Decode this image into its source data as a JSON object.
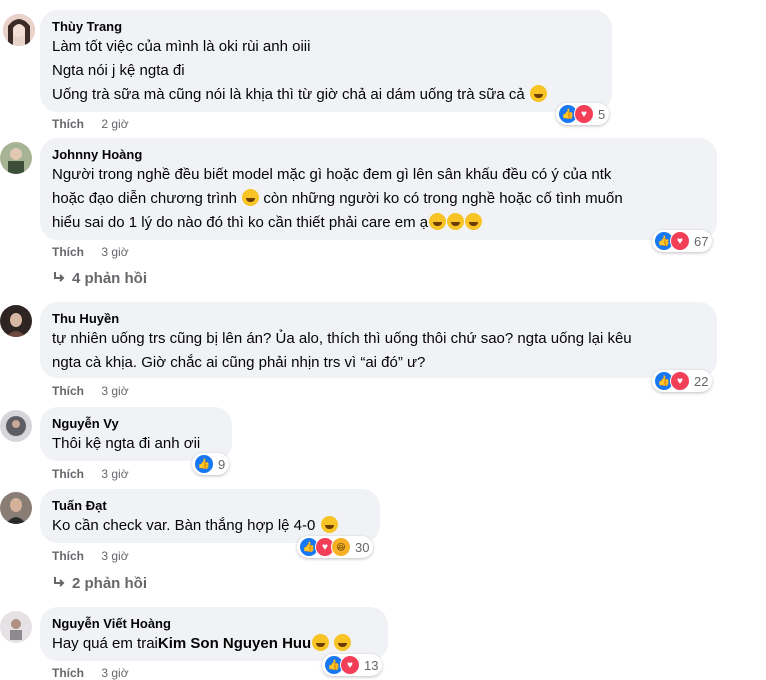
{
  "comments": [
    {
      "name": "Thùy Trang",
      "lines": [
        "Làm tốt việc của mình là oki rùi anh oiii",
        "Ngta nói j kệ ngta đi",
        "Uống trà sữa mà cũng nói là khịa thì từ giờ chả ai dám uống trà sữa cả"
      ],
      "like_label": "Thích",
      "time": "2 giờ",
      "reaction_count": "5",
      "avatar_color": "#d9b8b0"
    },
    {
      "name": "Johnny Hoàng",
      "lines": [
        "Người trong nghề đều biết model mặc gì hoặc đem gì lên sân khấu đều có ý của ntk",
        "hoặc đạo diễn chương trình",
        "còn những người ko có trong nghề hoặc cố tình muốn",
        "hiểu sai do 1 lý do nào đó thì ko cần thiết phải care em ạ"
      ],
      "like_label": "Thích",
      "time": "3 giờ",
      "reaction_count": "67",
      "replies": "4 phản hồi",
      "avatar_color": "#8c9a7a"
    },
    {
      "name": "Thu Huyền",
      "lines": [
        "tự nhiên uống trs cũng bị lên án? Ủa alo, thích thì uống thôi chứ sao? ngta uống lại kêu",
        "ngta cà khịa. Giờ chắc ai cũng phải nhịn trs vì “ai đó” ư?"
      ],
      "like_label": "Thích",
      "time": "3 giờ",
      "reaction_count": "22",
      "avatar_color": "#4a3a35"
    },
    {
      "name": "Nguyễn Vy",
      "lines": [
        "Thôi kệ ngta đi anh ơii"
      ],
      "like_label": "Thích",
      "time": "3 giờ",
      "reaction_count": "9",
      "avatar_color": "#7c7c86"
    },
    {
      "name": "Tuấn Đạt",
      "lines": [
        "Ko cần check var. Bàn thắng hợp lệ 4-0"
      ],
      "like_label": "Thích",
      "time": "3 giờ",
      "reaction_count": "30",
      "replies": "2 phản hồi",
      "avatar_color": "#5a4e48"
    },
    {
      "name": "Nguyễn Viết Hoàng",
      "lines": [
        "Hay quá em trai"
      ],
      "mention": "Kim Son Nguyen Huu",
      "like_label": "Thích",
      "time": "3 giờ",
      "reaction_count": "13",
      "avatar_color": "#c9c3c6"
    }
  ],
  "colors": {
    "like": "#1877f2",
    "love": "#f33e58",
    "haha": "#f7b125",
    "bubble": "#f0f2f5",
    "meta": "#65676b"
  },
  "icons": {
    "reply_arrow": "reply-arrow-icon",
    "like": "like-icon",
    "love": "love-icon",
    "haha": "haha-icon"
  }
}
